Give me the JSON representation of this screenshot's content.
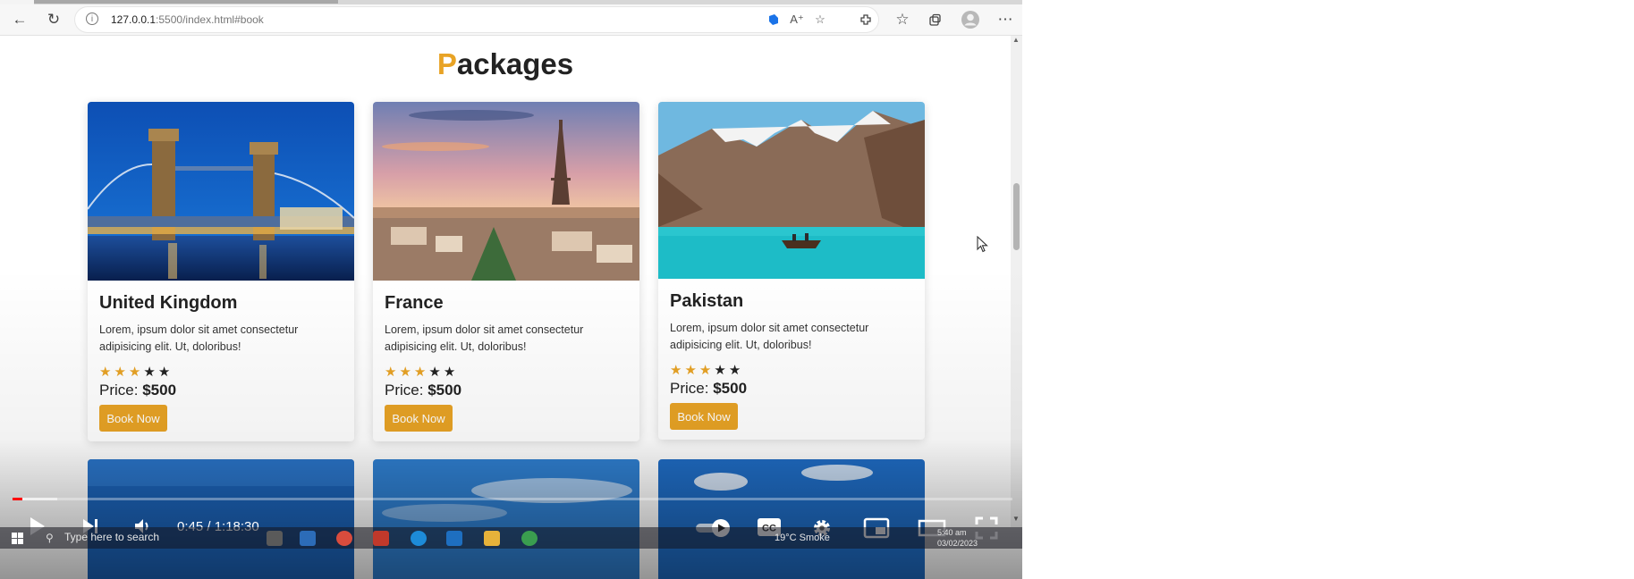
{
  "browser": {
    "url_host": "127.0.0.1",
    "url_rest": ":5500/index.html#book",
    "address_full": "127.0.0.1:5500/index.html#book"
  },
  "page": {
    "heading_first_letter": "P",
    "heading_rest": "ackages",
    "accent_color": "#e8a325"
  },
  "packages": [
    {
      "name": "United Kingdom",
      "description": "Lorem, ipsum dolor sit amet consectetur adipisicing elit. Ut, doloribus!",
      "rating": 3,
      "rating_max": 5,
      "price_label": "Price:",
      "price_value": "$500",
      "button_label": "Book Now"
    },
    {
      "name": "France",
      "description": "Lorem, ipsum dolor sit amet consectetur adipisicing elit. Ut, doloribus!",
      "rating": 3,
      "rating_max": 5,
      "price_label": "Price:",
      "price_value": "$500",
      "button_label": "Book Now"
    },
    {
      "name": "Pakistan",
      "description": "Lorem, ipsum dolor sit amet consectetur adipisicing elit. Ut, doloribus!",
      "rating": 3,
      "rating_max": 5,
      "price_label": "Price:",
      "price_value": "$500",
      "button_label": "Book Now"
    }
  ],
  "player": {
    "timecode": "0:45 / 1:18:30",
    "progress_fraction": 0.0096,
    "icons": [
      "play-icon",
      "next-icon",
      "volume-icon",
      "autoplay-toggle-icon",
      "captions-icon",
      "settings-icon",
      "miniplayer-icon",
      "theater-icon",
      "fullscreen-icon"
    ]
  },
  "taskbar": {
    "search_placeholder": "Type here to search",
    "weather": "19°C  Smoke",
    "time": "5:40 am",
    "date": "03/02/2023"
  }
}
